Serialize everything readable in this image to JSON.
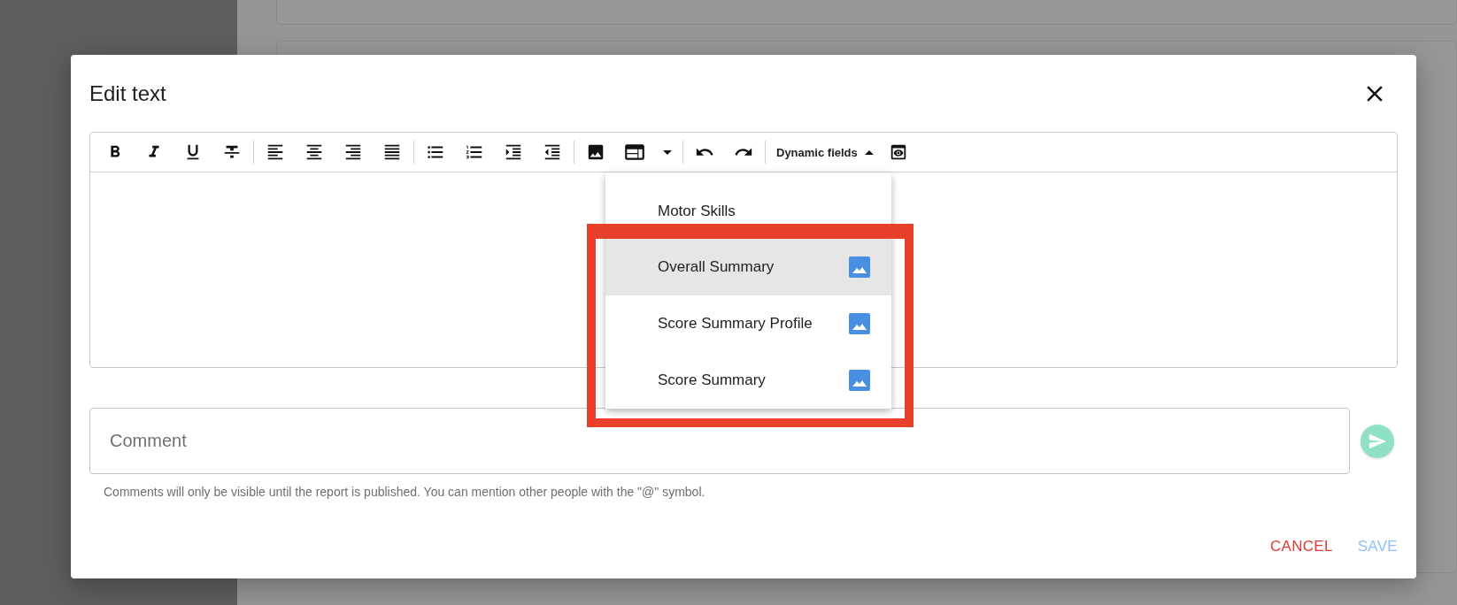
{
  "dialog": {
    "title": "Edit text"
  },
  "toolbar": {
    "dynamic_fields_label": "Dynamic fields"
  },
  "dropdown": {
    "items": [
      {
        "label": "Motor Skills",
        "kind": "text",
        "selected": false
      },
      {
        "label": "Overall Summary",
        "kind": "image",
        "selected": true
      },
      {
        "label": "Score Summary Profile",
        "kind": "image",
        "selected": false
      },
      {
        "label": "Score Summary",
        "kind": "image",
        "selected": false
      }
    ]
  },
  "comment": {
    "placeholder": "Comment",
    "helper": "Comments will only be visible until the report is published. You can mention other people with the \"@\" symbol.",
    "send_disabled": true
  },
  "buttons": [
    {
      "label": "CANCEL",
      "kind": "cancel",
      "disabled": false
    },
    {
      "label": "SAVE",
      "kind": "save",
      "disabled": true
    }
  ]
}
